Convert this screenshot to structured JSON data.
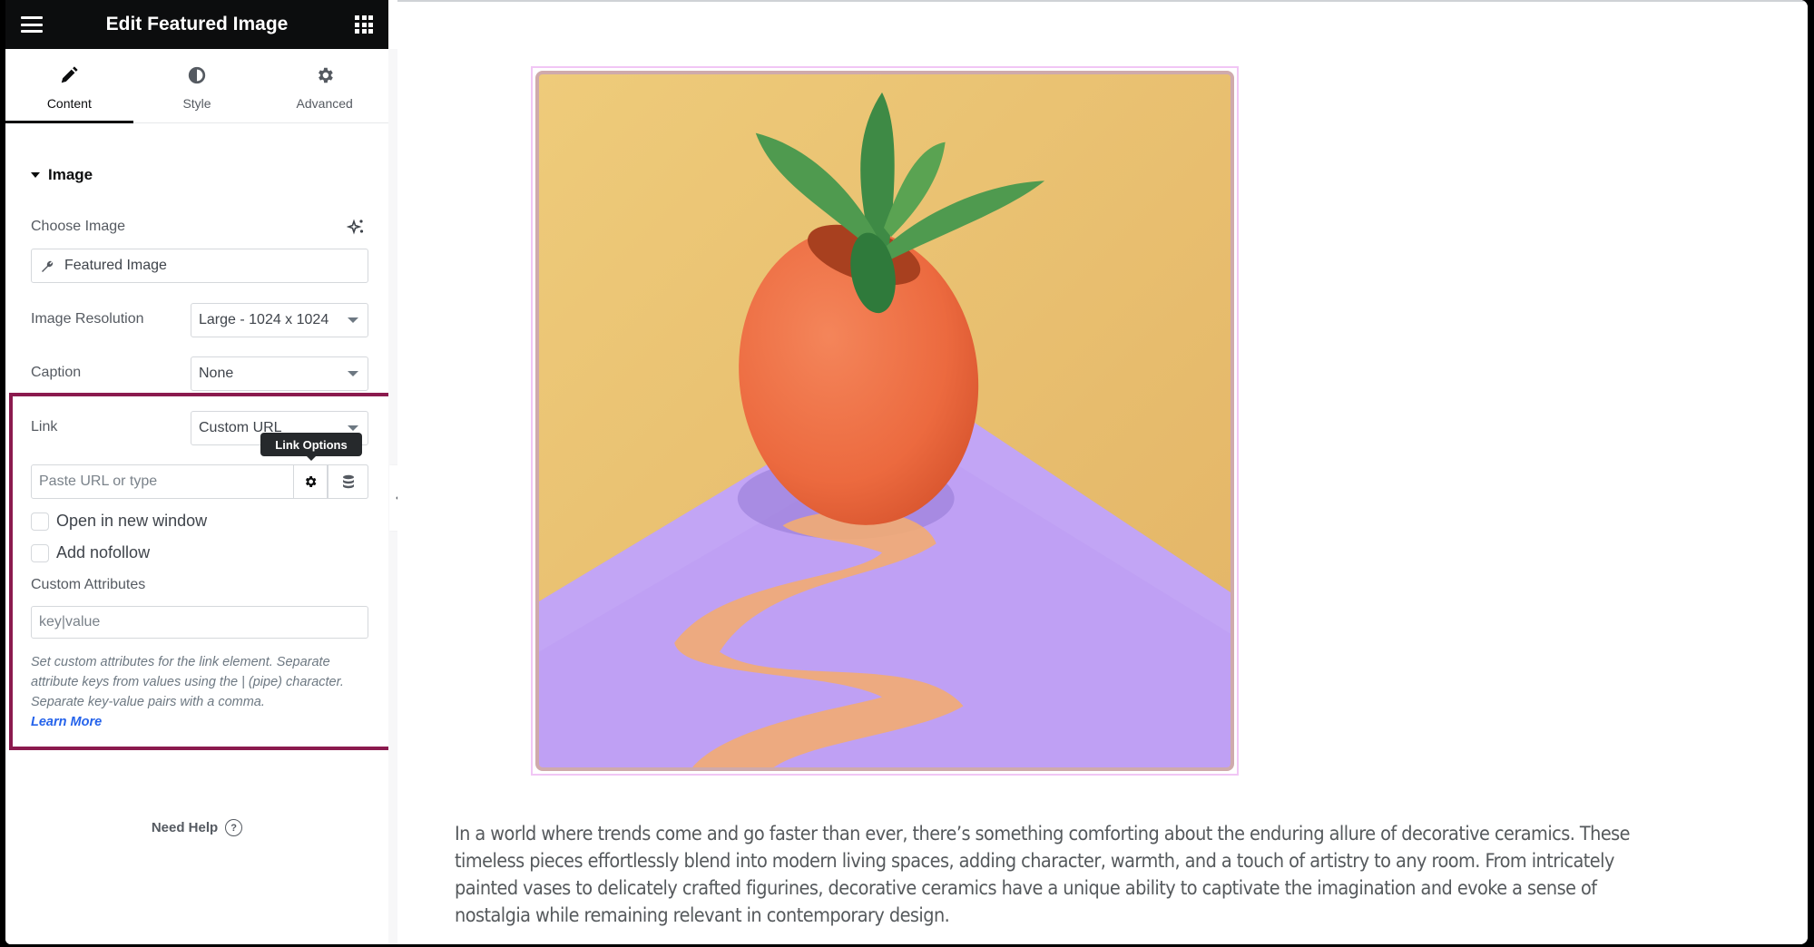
{
  "sidebar": {
    "header": {
      "title": "Edit Featured Image",
      "menu_icon": "hamburger-icon",
      "apps_icon": "grid-icon"
    },
    "tabs": [
      {
        "label": "Content",
        "icon": "pencil-icon",
        "active": true
      },
      {
        "label": "Style",
        "icon": "contrast-icon",
        "active": false
      },
      {
        "label": "Advanced",
        "icon": "gear-icon",
        "active": false
      }
    ],
    "section": {
      "title": "Image"
    },
    "choose_image": {
      "label": "Choose Image",
      "ai_icon": "sparkle-icon",
      "value": "Featured Image",
      "value_icon": "wrench-icon"
    },
    "image_resolution": {
      "label": "Image Resolution",
      "value": "Large - 1024 x 1024"
    },
    "caption": {
      "label": "Caption",
      "value": "None"
    },
    "link": {
      "label": "Link",
      "value": "Custom URL",
      "url_placeholder": "Paste URL or type",
      "tooltip": "Link Options",
      "options_icon": "gear-icon",
      "dynamic_icon": "database-icon",
      "open_new_window": {
        "label": "Open in new window",
        "checked": false
      },
      "nofollow": {
        "label": "Add nofollow",
        "checked": false
      },
      "custom_attributes": {
        "label": "Custom Attributes",
        "placeholder": "key|value",
        "help": "Set custom attributes for the link element. Separate attribute keys from values using the | (pipe) character. Separate key-value pairs with a comma.",
        "learn_more": "Learn More"
      }
    },
    "need_help": "Need Help",
    "highlight_color": "#8b1a4e"
  },
  "preview": {
    "image_alt": "Orange spherical ceramic planter with a succulent on a purple surface against a yellow wall",
    "paragraph": "In a world where trends come and go faster than ever, there’s something comforting about the enduring allure of decorative ceramics. These timeless pieces effortlessly blend into modern living spaces, adding character, warmth, and a touch of artistry to any room. From intricately painted vases to delicately crafted figurines, decorative ceramics have a unique ability to captivate the imagination and evoke a sense of nostalgia while remaining relevant in contemporary design."
  }
}
